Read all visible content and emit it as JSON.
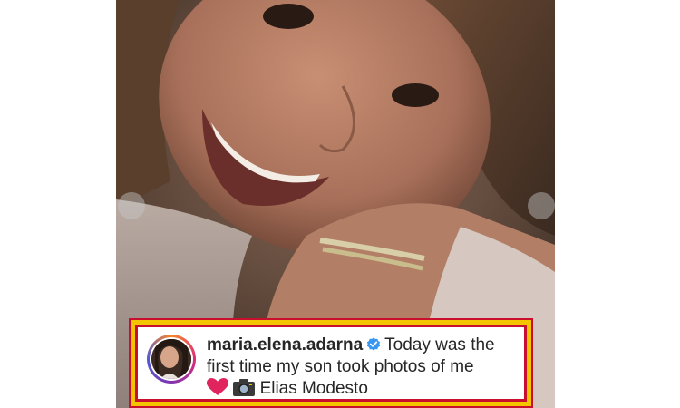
{
  "post": {
    "username": "maria.elena.adarna",
    "verified": true,
    "caption_line1": "Today was the",
    "caption_line2": "first time my son took photos of me",
    "mention": "Elias Modesto",
    "emojis": [
      "heart-icon",
      "camera-icon"
    ]
  },
  "colors": {
    "frame_outer": "#c8102e",
    "frame_inner": "#f5c400",
    "verified_blue": "#3897f0",
    "heart_red": "#e0245e"
  }
}
